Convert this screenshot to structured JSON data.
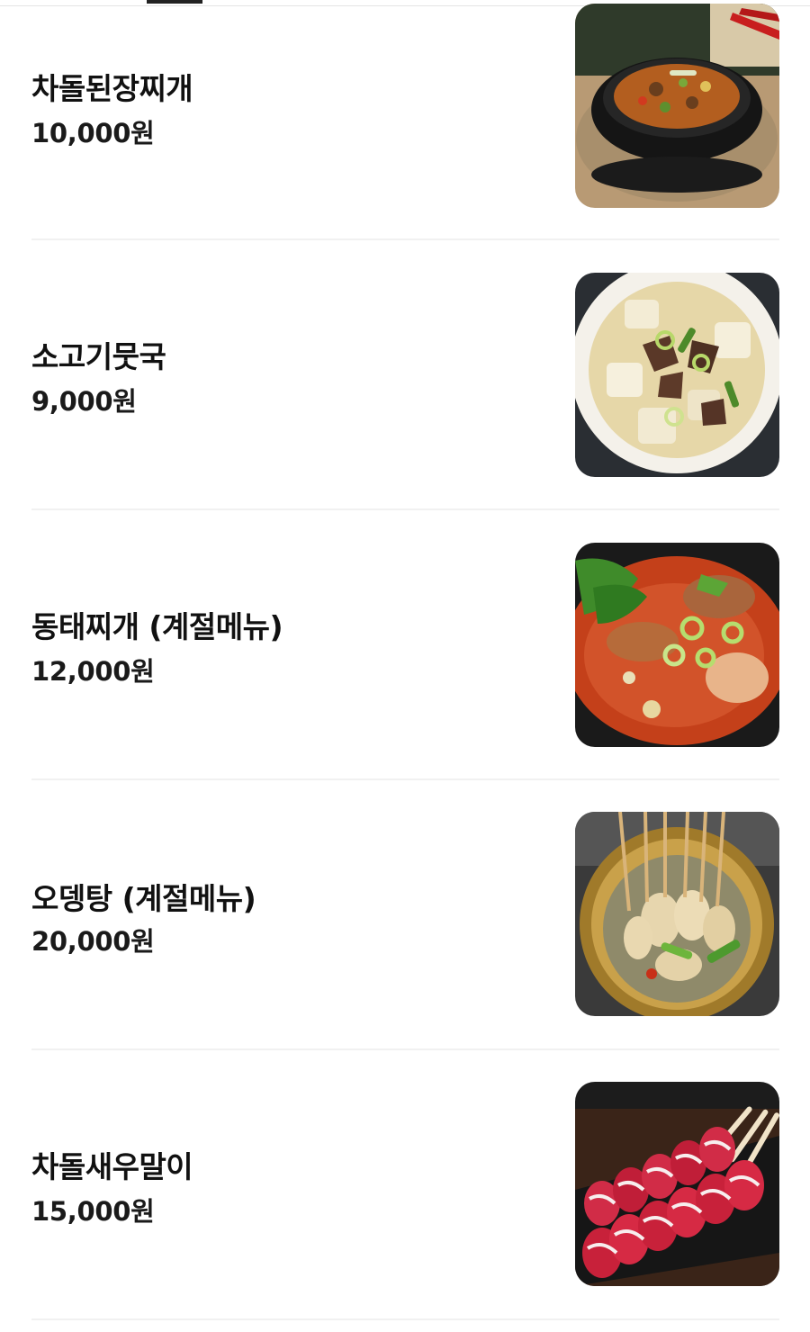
{
  "menu": {
    "items": [
      {
        "name": "차돌된장찌개",
        "price": "10,000원",
        "photo": "doenjang-jjigae-photo"
      },
      {
        "name": "소고기뭇국",
        "price": "9,000원",
        "photo": "beef-radish-soup-photo"
      },
      {
        "name": "동태찌개 (계절메뉴)",
        "price": "12,000원",
        "photo": "pollock-stew-photo"
      },
      {
        "name": "오뎅탕 (계절메뉴)",
        "price": "20,000원",
        "photo": "fishcake-soup-photo"
      },
      {
        "name": "차돌새우말이",
        "price": "15,000원",
        "photo": "brisket-shrimp-roll-photo"
      }
    ]
  },
  "colors": {
    "text": "#111111",
    "divider": "#f1f1f1",
    "tab_indicator": "#222222"
  }
}
